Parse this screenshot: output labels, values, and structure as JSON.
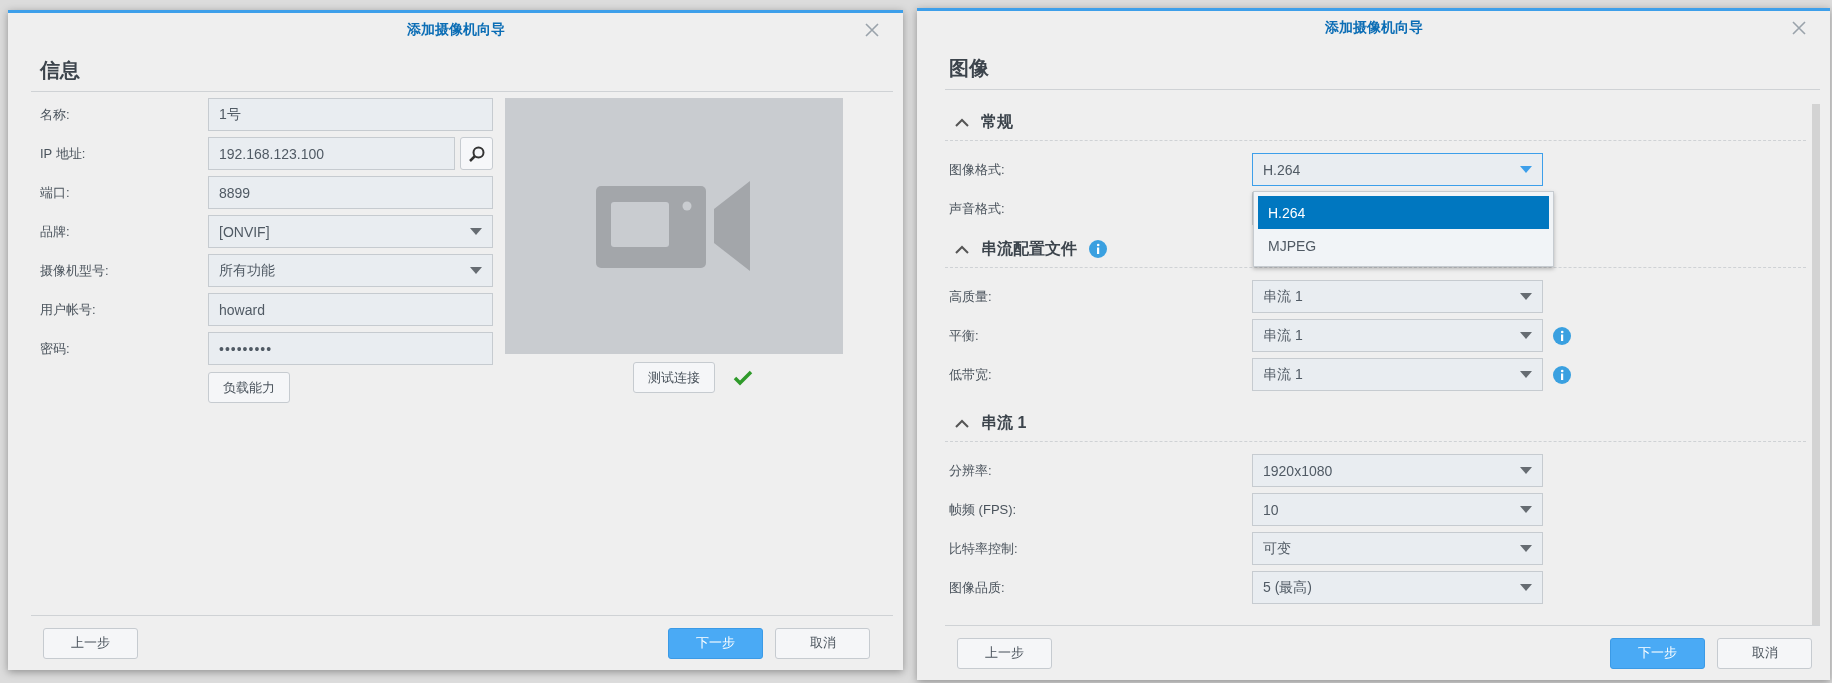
{
  "info_dialog": {
    "title": "添加摄像机向导",
    "heading": "信息",
    "fields": [
      {
        "label": "名称:",
        "value": "1号",
        "kind": "text"
      },
      {
        "label": "IP 地址:",
        "value": "192.168.123.100",
        "kind": "search"
      },
      {
        "label": "端口:",
        "value": "8899",
        "kind": "text"
      },
      {
        "label": "品牌:",
        "value": "[ONVIF]",
        "kind": "select"
      },
      {
        "label": "摄像机型号:",
        "value": "所有功能",
        "kind": "select"
      },
      {
        "label": "用户帐号:",
        "value": "howard",
        "kind": "text"
      },
      {
        "label": "密码:",
        "value": "•••••••••",
        "kind": "password"
      }
    ],
    "capability_button": "负载能力",
    "test_button": "测试连接",
    "test_passed": true,
    "footer_buttons": [
      {
        "label": "上一步",
        "kind": "secondary"
      },
      {
        "label": "下一步",
        "kind": "primary"
      },
      {
        "label": "取消",
        "kind": "secondary"
      }
    ]
  },
  "image_dialog": {
    "title": "添加摄像机向导",
    "heading": "图像",
    "sections": [
      {
        "title": "常规",
        "expanded": true,
        "info": false,
        "rows": [
          {
            "label": "图像格式:",
            "value": "H.264",
            "focused": true,
            "info": false,
            "menu": [
              {
                "label": "H.264",
                "selected": true
              },
              {
                "label": "MJPEG",
                "selected": false
              }
            ]
          },
          {
            "label": "声音格式:",
            "focused": false,
            "info": false
          }
        ]
      },
      {
        "title": "串流配置文件",
        "expanded": true,
        "info": true,
        "rows": [
          {
            "label": "高质量:",
            "value": "串流 1",
            "focused": false,
            "info": false
          },
          {
            "label": "平衡:",
            "value": "串流 1",
            "focused": false,
            "info": true
          },
          {
            "label": "低带宽:",
            "value": "串流 1",
            "focused": false,
            "info": true
          }
        ]
      },
      {
        "title": "串流 1",
        "expanded": true,
        "info": false,
        "rows": [
          {
            "label": "分辨率:",
            "value": "1920x1080",
            "focused": false,
            "info": false
          },
          {
            "label": "帧频 (FPS):",
            "value": "10",
            "focused": false,
            "info": false
          },
          {
            "label": "比特率控制:",
            "value": "可变",
            "focused": false,
            "info": false
          },
          {
            "label": "图像品质:",
            "value": "5 (最高)",
            "focused": false,
            "info": false
          }
        ]
      }
    ],
    "footer_buttons": [
      {
        "label": "上一步",
        "kind": "secondary"
      },
      {
        "label": "下一步",
        "kind": "primary"
      },
      {
        "label": "取消",
        "kind": "secondary"
      }
    ]
  }
}
